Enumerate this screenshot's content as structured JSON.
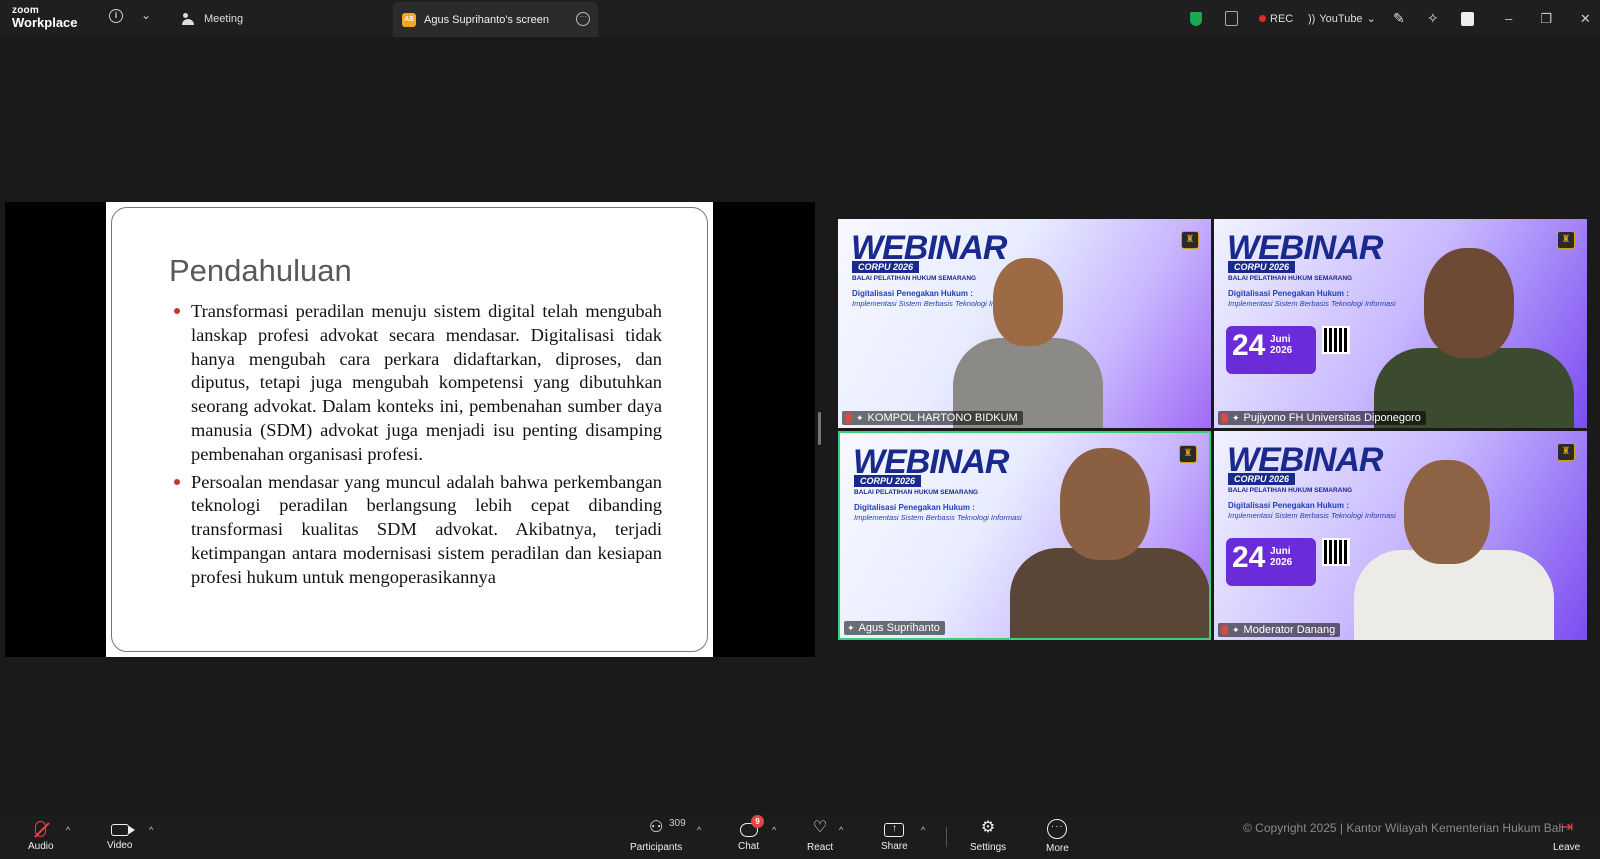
{
  "app": {
    "logo_line1": "zoom",
    "logo_line2": "Workplace"
  },
  "tabs": {
    "meeting": "Meeting",
    "screen_badge": "AS",
    "screen": "Agus Suprihanto's screen"
  },
  "topbar_right": {
    "rec": "REC",
    "youtube": "YouTube"
  },
  "slide": {
    "title": "Pendahuluan",
    "bullets": [
      "Transformasi peradilan menuju sistem digital telah mengubah lanskap profesi advokat secara mendasar. Digitalisasi tidak hanya mengubah cara perkara didaftarkan, diproses, dan diputus, tetapi juga mengubah kompetensi yang dibutuhkan seorang advokat. Dalam konteks ini, pembenahan sumber daya manusia (SDM) advokat juga menjadi isu penting disamping pembenahan organisasi profesi.",
      "Persoalan mendasar yang muncul adalah bahwa perkembangan teknologi peradilan berlangsung lebih cepat dibanding transformasi kualitas SDM advokat. Akibatnya, terjadi ketimpangan antara modernisasi sistem peradilan dan kesiapan profesi hukum untuk mengoperasikannya"
    ]
  },
  "webinar": {
    "title": "WEBINAR",
    "sub": "CORPU 2026",
    "org": "BALAI PELATIHAN HUKUM SEMARANG",
    "topic": "Digitalisasi Penegakan Hukum :",
    "topic_sub": "Implementasi Sistem Berbasis Teknologi Informasi",
    "date_day": "24",
    "date_month": "Juni",
    "date_year": "2026"
  },
  "participants": [
    {
      "name": "KOMPOL HARTONO BIDKUM"
    },
    {
      "name": "Pujiyono FH Universitas Diponegoro"
    },
    {
      "name": "Agus Suprihanto"
    },
    {
      "name": "Moderator Danang"
    }
  ],
  "toolbar": {
    "audio": "Audio",
    "video": "Video",
    "participants": "Participants",
    "participants_count": "309",
    "chat": "Chat",
    "chat_badge": "9",
    "react": "React",
    "share": "Share",
    "settings": "Settings",
    "more": "More",
    "leave": "Leave"
  },
  "copyright": "© Copyright 2025 | Kantor Wilayah Kementerian Hukum Bali",
  "colors": {
    "accent_green": "#3ccf7a",
    "rec_red": "#e02a2a",
    "webinar_blue": "#1a2a8c"
  }
}
